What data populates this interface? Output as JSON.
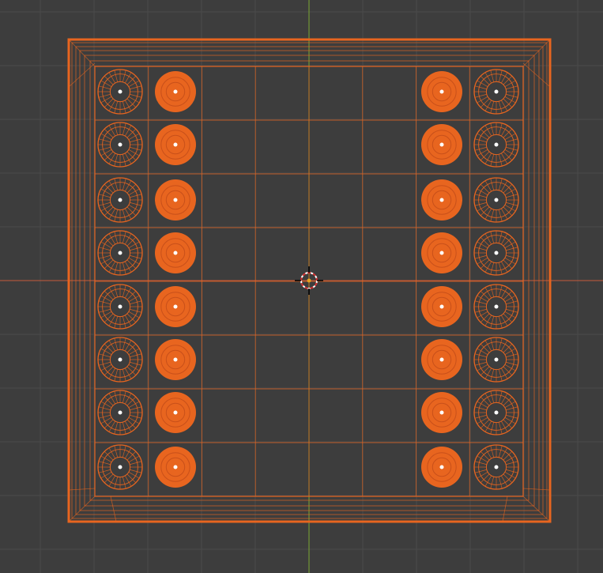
{
  "viewport": {
    "background": "#3d3d3d",
    "grid_color": "#4a4a4a",
    "x_axis_color": "#c85a3a",
    "y_axis_color": "#7aa834"
  },
  "selection_color": "#e8651f",
  "board": {
    "state": "selected",
    "display": "wireframe"
  },
  "pieces": {
    "left_back_rank": [
      "wire",
      "wire",
      "wire",
      "wire",
      "wire",
      "wire",
      "wire",
      "wire"
    ],
    "left_pawns": [
      "solid",
      "solid",
      "solid",
      "solid",
      "solid",
      "solid",
      "solid",
      "solid"
    ],
    "right_pawns": [
      "solid",
      "solid",
      "solid",
      "solid",
      "solid",
      "solid",
      "solid",
      "solid"
    ],
    "right_back_rank": [
      "wire",
      "wire",
      "wire",
      "wire",
      "wire",
      "wire",
      "wire",
      "wire"
    ]
  },
  "icons": {
    "cursor": "3d-cursor-icon"
  }
}
